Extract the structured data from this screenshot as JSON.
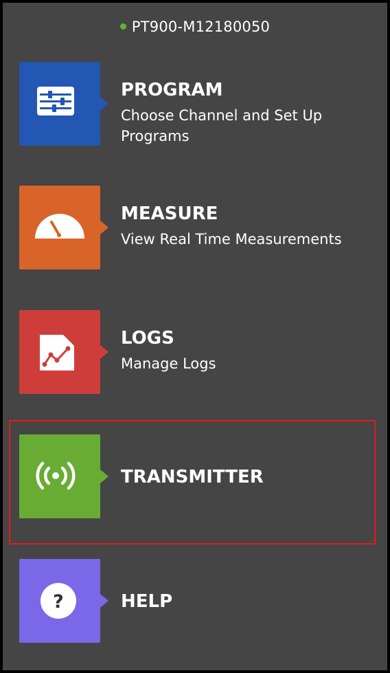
{
  "device": {
    "id": "PT900-M12180050",
    "status_color": "#62b32e"
  },
  "menu": [
    {
      "title": "PROGRAM",
      "description": "Choose Channel and Set Up Programs",
      "icon": "sliders-icon",
      "color": "#2456b3"
    },
    {
      "title": "MEASURE",
      "description": "View Real Time Measurements",
      "icon": "gauge-icon",
      "color": "#d8642a"
    },
    {
      "title": "LOGS",
      "description": "Manage Logs",
      "icon": "log-chart-icon",
      "color": "#cf3d3a"
    },
    {
      "title": "TRANSMITTER",
      "description": "",
      "icon": "wireless-signal-icon",
      "color": "#68ac34",
      "highlighted": true,
      "highlight_color": "#e01b1b"
    },
    {
      "title": "HELP",
      "description": "",
      "icon": "help-icon",
      "color": "#7b68e8"
    }
  ]
}
